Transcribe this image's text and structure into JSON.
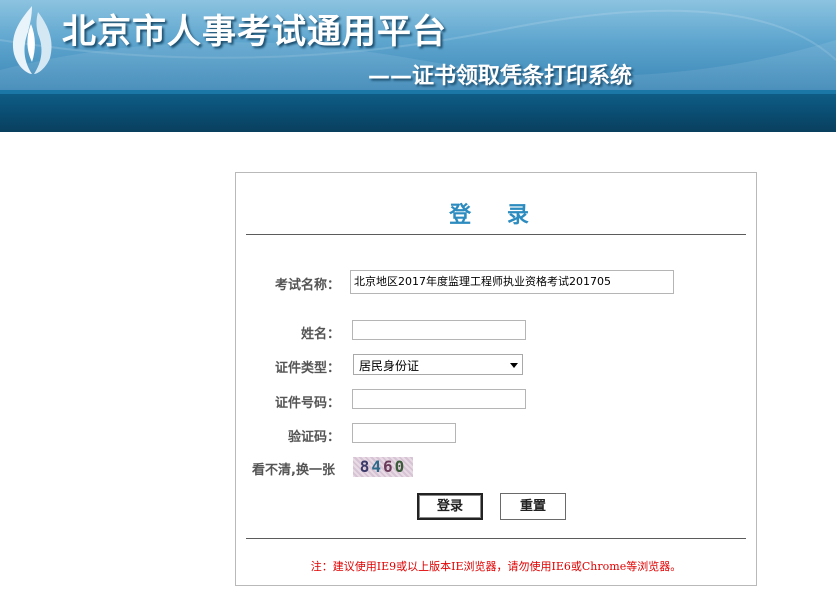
{
  "header": {
    "title": "北京市人事考试通用平台",
    "subtitle": "——证书领取凭条打印系统",
    "colors": {
      "banner_light": "#8cc3e0",
      "banner_dark": "#3a86b6",
      "nav_band": "#0a4c70"
    }
  },
  "login": {
    "title": "登 录",
    "title_color": "#2c8bbf",
    "fields": {
      "exam_name_label": "考试名称：",
      "exam_name_value": "北京地区2017年度监理工程师执业资格考试201705",
      "name_label": "姓名：",
      "name_value": "",
      "id_type_label": "证件类型：",
      "id_type_value": "居民身份证",
      "id_number_label": "证件号码：",
      "id_number_value": "",
      "captcha_label": "验证码：",
      "captcha_value": "",
      "refresh_captcha_label": "看不清,换一张",
      "captcha_digits": [
        "8",
        "4",
        "6",
        "0"
      ]
    },
    "buttons": {
      "login": "登录",
      "reset": "重置"
    },
    "notice": "注：建议使用IE9或以上版本IE浏览器，请勿使用IE6或Chrome等浏览器。",
    "notice_color": "#e00000"
  }
}
